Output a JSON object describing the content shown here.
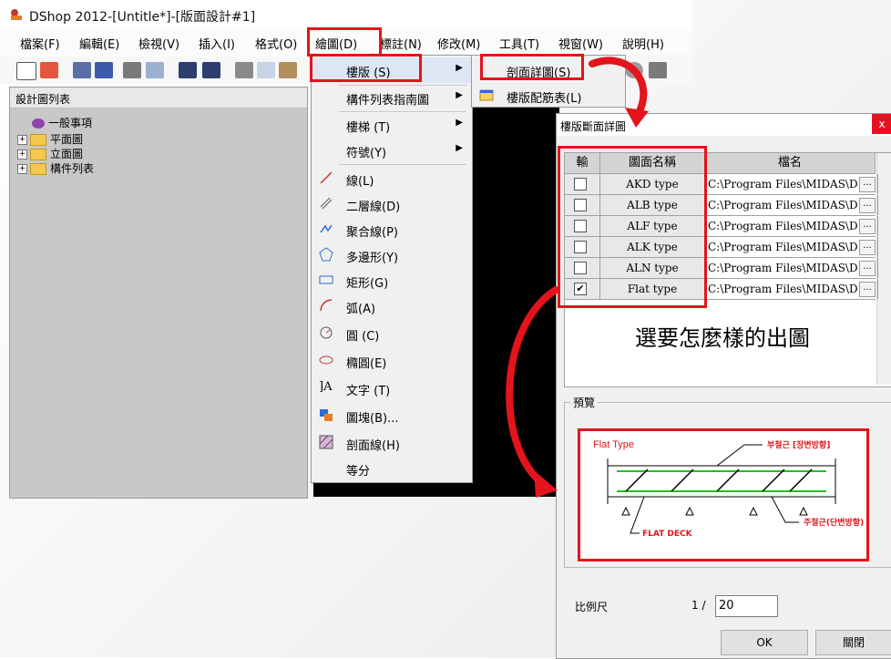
{
  "window": {
    "title": "DShop 2012-[Untitle*]-[版面設計#1]"
  },
  "menubar": [
    "檔案(F)",
    "編輯(E)",
    "檢視(V)",
    "插入(I)",
    "格式(O)",
    "繪圖(D)",
    "標註(N)",
    "修改(M)",
    "工具(T)",
    "視窗(W)",
    "說明(H)"
  ],
  "panel": {
    "title": "設計圖列表",
    "tree": [
      {
        "label": "一般事項",
        "toggle": ""
      },
      {
        "label": "平面圖",
        "toggle": "+"
      },
      {
        "label": "立面圖",
        "toggle": "+"
      },
      {
        "label": "構件列表",
        "toggle": "+"
      }
    ]
  },
  "draw_menu": {
    "items": [
      {
        "label": "樓版 (S)",
        "submenu": true
      },
      {
        "label": "構件列表指南圖",
        "submenu": true
      },
      {
        "label": "樓梯 (T)",
        "submenu": true
      },
      {
        "label": "符號(Y)",
        "submenu": true
      },
      {
        "label": "線(L)"
      },
      {
        "label": "二層線(D)"
      },
      {
        "label": "聚合線(P)"
      },
      {
        "label": "多邊形(Y)"
      },
      {
        "label": "矩形(G)"
      },
      {
        "label": "弧(A)"
      },
      {
        "label": "圓 (C)"
      },
      {
        "label": "橢圓(E)"
      },
      {
        "label": "文字 (T)"
      },
      {
        "label": "圖塊(B)..."
      },
      {
        "label": "剖面線(H)"
      },
      {
        "label": "等分"
      }
    ]
  },
  "sub_menu": {
    "items": [
      "剖面詳圖(S)",
      "樓版配筋表(L)"
    ]
  },
  "dialog": {
    "title": "樓版斷面詳圖",
    "close": "x",
    "columns": [
      "輸",
      "圖面名稱",
      "檔名"
    ],
    "rows": [
      {
        "checked": false,
        "name": "AKD type",
        "file": "C:\\Program Files\\MIDAS\\D"
      },
      {
        "checked": false,
        "name": "ALB type",
        "file": "C:\\Program Files\\MIDAS\\D"
      },
      {
        "checked": false,
        "name": "ALF type",
        "file": "C:\\Program Files\\MIDAS\\D"
      },
      {
        "checked": false,
        "name": "ALK type",
        "file": "C:\\Program Files\\MIDAS\\D"
      },
      {
        "checked": false,
        "name": "ALN type",
        "file": "C:\\Program Files\\MIDAS\\D"
      },
      {
        "checked": true,
        "name": "Flat type",
        "file": "C:\\Program Files\\MIDAS\\D"
      }
    ],
    "browse": "...",
    "annotation": "選要怎麼樣的出圖",
    "preview_label": "預覽",
    "preview": {
      "title": "Flat Type",
      "top_label": "부철근 [장변방향]",
      "bottom_label": "주철근(단변방향)",
      "deck_label": "FLAT DECK"
    },
    "scale_label": "比例尺",
    "scale_prefix": "1 /",
    "scale_value": "20",
    "ok": "OK",
    "close_button": "關閉"
  },
  "colors": {
    "highlight": "#e3141b",
    "canvas": "#000000",
    "rebar": "#1ec21e"
  }
}
